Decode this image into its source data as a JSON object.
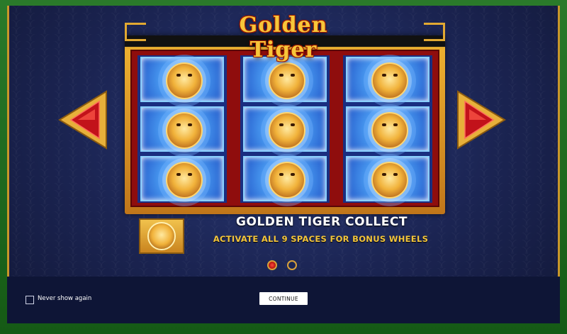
{
  "game": {
    "title": "Golden Tiger"
  },
  "reels": {
    "columns": 3,
    "rows": 3,
    "symbol": "golden-tiger-coin"
  },
  "info_page": {
    "feature_title": "GOLDEN TIGER COLLECT",
    "feature_description": "ACTIVATE ALL 9 SPACES FOR BONUS WHEELS",
    "pages_total": 2,
    "current_page": 1
  },
  "navigation": {
    "prev_icon": "left-arrow-icon",
    "next_icon": "right-arrow-icon"
  },
  "footer": {
    "never_show_label": "Never show again",
    "never_show_checked": false,
    "continue_label": "CONTINUE"
  },
  "colors": {
    "accent_gold": "#f4c63c",
    "panel_blue": "#1b2452",
    "frame_green": "#1f6b1f",
    "arrow_red": "#c2121a"
  }
}
